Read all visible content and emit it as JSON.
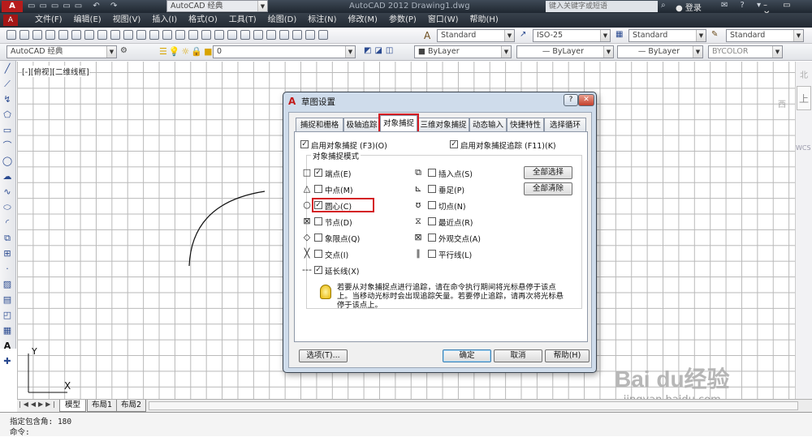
{
  "app": {
    "title": "AutoCAD 2012   Drawing1.dwg",
    "workspace": "AutoCAD 经典",
    "search_placeholder": "键入关键字或短语",
    "login": "登录"
  },
  "menu": {
    "items": [
      "文件(F)",
      "编辑(E)",
      "视图(V)",
      "插入(I)",
      "格式(O)",
      "工具(T)",
      "绘图(D)",
      "标注(N)",
      "修改(M)",
      "参数(P)",
      "窗口(W)",
      "帮助(H)"
    ]
  },
  "toolbar": {
    "textstyle": "Standard",
    "dimstyle": "ISO-25",
    "tablestyle": "Standard",
    "mlstyle": "Standard",
    "workspace2": "AutoCAD 经典",
    "layer": "0",
    "color": "ByLayer",
    "linetype": "ByLayer",
    "lineweight": "ByLayer",
    "plotstyle": "BYCOLOR"
  },
  "viewport": {
    "label": "[-][俯视][二维线框]",
    "ucs_y": "Y",
    "ucs_x": "X"
  },
  "viewcube": {
    "north": "北",
    "top": "上",
    "west": "西",
    "wcs": "WCS"
  },
  "layout_tabs": [
    "模型",
    "布局1",
    "布局2"
  ],
  "command": {
    "line1": "指定包含角: 180",
    "line2": "命令:"
  },
  "watermark": {
    "brand": "Bai du经验",
    "url": "jingyan.baidu.com"
  },
  "dialog": {
    "title": "草图设置",
    "tabs": [
      "捕捉和栅格",
      "极轴追踪",
      "对象捕捉",
      "三维对象捕捉",
      "动态输入",
      "快捷特性",
      "选择循环"
    ],
    "enable_osnap": "启用对象捕捉 (F3)(O)",
    "enable_tracking": "启用对象捕捉追踪 (F11)(K)",
    "group_title": "对象捕捉模式",
    "modes_left": [
      {
        "symbol": "□",
        "label": "端点(E)",
        "checked": true
      },
      {
        "symbol": "△",
        "label": "中点(M)",
        "checked": false
      },
      {
        "symbol": "○",
        "label": "圆心(C)",
        "checked": true
      },
      {
        "symbol": "⊠",
        "label": "节点(D)",
        "checked": false
      },
      {
        "symbol": "◇",
        "label": "象限点(Q)",
        "checked": false
      },
      {
        "symbol": "╳",
        "label": "交点(I)",
        "checked": false
      },
      {
        "symbol": "---",
        "label": "延长线(X)",
        "checked": true
      }
    ],
    "modes_right": [
      {
        "symbol": "⧉",
        "label": "插入点(S)",
        "checked": false
      },
      {
        "symbol": "⊾",
        "label": "垂足(P)",
        "checked": false
      },
      {
        "symbol": "ʊ",
        "label": "切点(N)",
        "checked": false
      },
      {
        "symbol": "⧖",
        "label": "最近点(R)",
        "checked": false
      },
      {
        "symbol": "⊠",
        "label": "外观交点(A)",
        "checked": false
      },
      {
        "symbol": "∥",
        "label": "平行线(L)",
        "checked": false
      }
    ],
    "select_all": "全部选择",
    "clear_all": "全部清除",
    "hint": "若要从对象捕捉点进行追踪，请在命令执行期间将光标悬停于该点上。当移动光标时会出现追踪矢量。若要停止追踪，请再次将光标悬停于该点上。",
    "options": "选项(T)...",
    "ok": "确定",
    "cancel": "取消",
    "help": "帮助(H)"
  }
}
